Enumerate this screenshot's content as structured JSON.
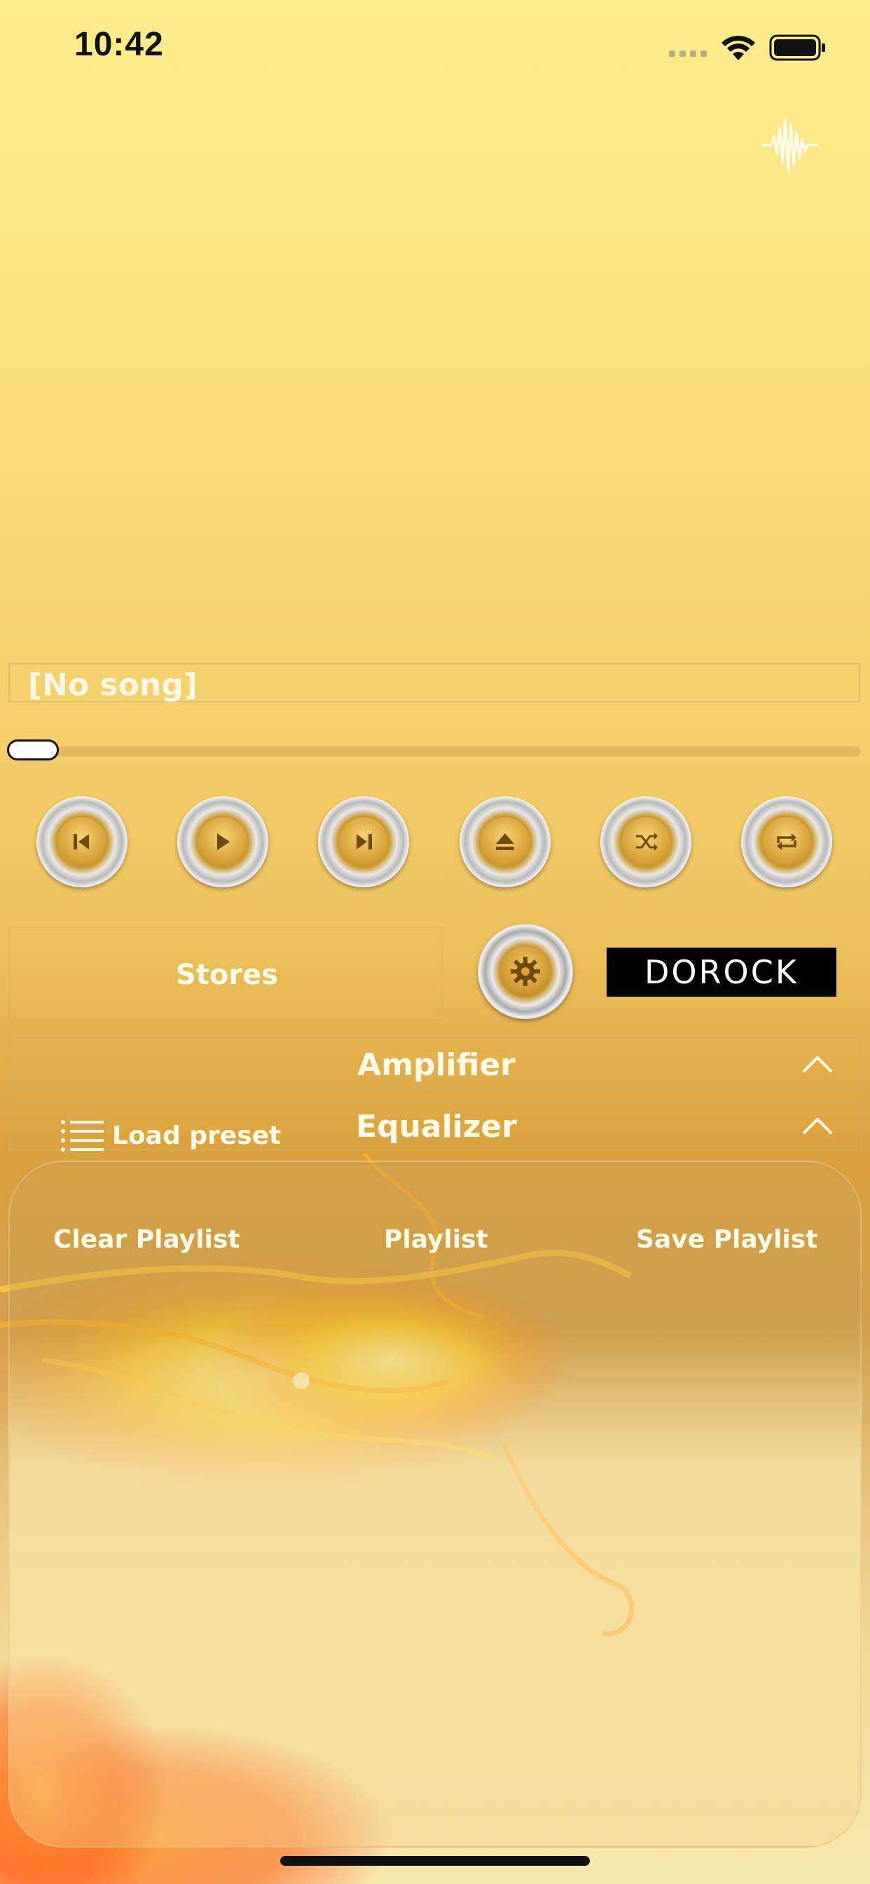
{
  "status_bar": {
    "time": "10:42"
  },
  "player": {
    "song_title": "[No song]",
    "progress": 0.0
  },
  "controls": [
    {
      "name": "previous-track-button",
      "icon": "previous-icon"
    },
    {
      "name": "play-button",
      "icon": "play-icon"
    },
    {
      "name": "next-track-button",
      "icon": "next-icon"
    },
    {
      "name": "eject-button",
      "icon": "eject-icon"
    },
    {
      "name": "shuffle-button",
      "icon": "shuffle-icon"
    },
    {
      "name": "repeat-button",
      "icon": "repeat-icon"
    }
  ],
  "stores": {
    "label": "Stores"
  },
  "brand": {
    "logo_text": "DOROCK"
  },
  "sections": {
    "amplifier": "Amplifier",
    "equalizer": "Equalizer"
  },
  "preset": {
    "label": "Load preset"
  },
  "playlist": {
    "clear_label": "Clear Playlist",
    "title_label": "Playlist",
    "save_label": "Save Playlist"
  },
  "colors": {
    "accent_gold": "#d9a03c",
    "text_light": "#fffbe8"
  }
}
